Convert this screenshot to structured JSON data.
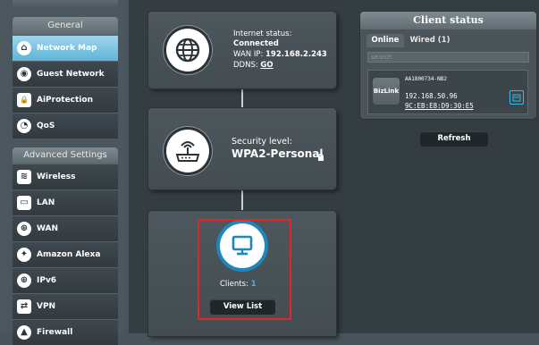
{
  "sidebar": {
    "general_title": "General",
    "general_items": [
      {
        "label": "Network Map",
        "icon": "network-map-icon",
        "glyph": "⌂"
      },
      {
        "label": "Guest Network",
        "icon": "guest-network-icon",
        "glyph": "◉"
      },
      {
        "label": "AiProtection",
        "icon": "lock-icon",
        "glyph": "🔒"
      },
      {
        "label": "QoS",
        "icon": "speedometer-icon",
        "glyph": "◔"
      }
    ],
    "advanced_title": "Advanced Settings",
    "advanced_items": [
      {
        "label": "Wireless",
        "icon": "wifi-icon",
        "glyph": "≋"
      },
      {
        "label": "LAN",
        "icon": "monitor-icon",
        "glyph": "▭"
      },
      {
        "label": "WAN",
        "icon": "globe-icon",
        "glyph": "⊕"
      },
      {
        "label": "Amazon Alexa",
        "icon": "alexa-icon",
        "glyph": "✦"
      },
      {
        "label": "IPv6",
        "icon": "ipv6-icon",
        "glyph": "⊕"
      },
      {
        "label": "VPN",
        "icon": "vpn-icon",
        "glyph": "⇄"
      },
      {
        "label": "Firewall",
        "icon": "firewall-icon",
        "glyph": "▲"
      }
    ]
  },
  "internet": {
    "status_label": "Internet status:",
    "status_value": "Connected",
    "wan_label": "WAN IP:",
    "wan_value": "192.168.2.243",
    "ddns_label": "DDNS:",
    "ddns_value": "GO"
  },
  "security": {
    "label": "Security level:",
    "value": "WPA2-Personal"
  },
  "clients": {
    "label": "Clients:",
    "count": "1",
    "view_list": "View List"
  },
  "client_status": {
    "title": "Client status",
    "tabs": {
      "online": "Online",
      "wired": "Wired (1)"
    },
    "search_placeholder": "search",
    "client": {
      "name": "AA1800734-NB2",
      "ip": "192.168.50.96",
      "mac": "9C:EB:E8:D9:30:E5",
      "vendor": "BizLink"
    },
    "refresh": "Refresh"
  },
  "colors": {
    "accent_blue": "#38b9e6",
    "highlight_red": "#e0262b",
    "active_menu": "#6ab9db"
  }
}
